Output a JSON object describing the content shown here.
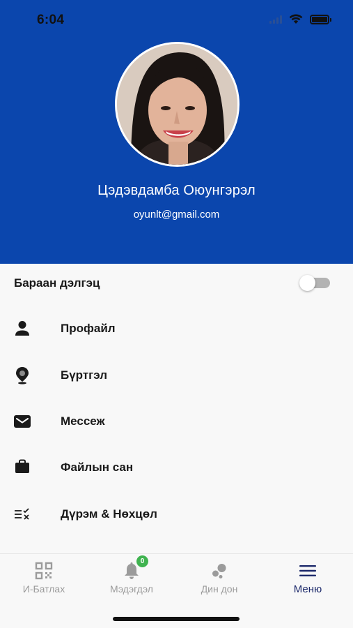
{
  "status_bar": {
    "time": "6:04"
  },
  "profile": {
    "name": "Цэдэвдамба Оюунгэрэл",
    "email": "oyunlt@gmail.com"
  },
  "settings": {
    "dark_mode_label": "Бараан дэлгэц",
    "dark_mode_enabled": false
  },
  "menu": {
    "items": [
      {
        "label": "Профайл",
        "icon": "person-icon"
      },
      {
        "label": "Бүртгэл",
        "icon": "location-pin-icon"
      },
      {
        "label": "Мессеж",
        "icon": "envelope-icon"
      },
      {
        "label": "Файлын сан",
        "icon": "briefcase-icon"
      },
      {
        "label": "Дүрэм & Нөхцөл",
        "icon": "checklist-icon"
      }
    ]
  },
  "tabbar": {
    "tabs": [
      {
        "label": "И-Батлах",
        "icon": "qr-code-icon",
        "active": false
      },
      {
        "label": "Мэдэгдэл",
        "icon": "bell-icon",
        "active": false,
        "badge": "0"
      },
      {
        "label": "Дин дон",
        "icon": "bubbles-icon",
        "active": false
      },
      {
        "label": "Меню",
        "icon": "hamburger-menu-icon",
        "active": true
      }
    ]
  },
  "colors": {
    "header_bg": "#0b46ad",
    "active_tab": "#1d2a6b",
    "badge": "#3fb34f"
  }
}
